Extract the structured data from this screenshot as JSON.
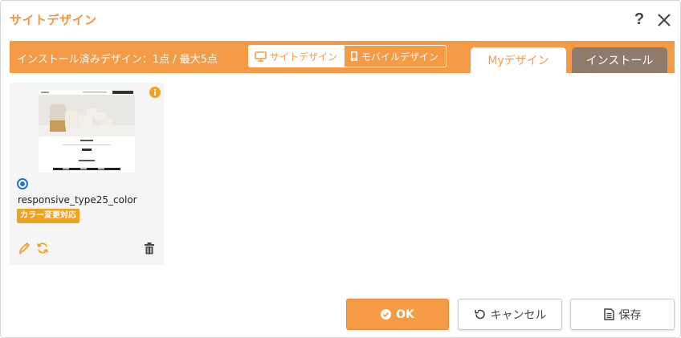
{
  "dialog": {
    "title": "サイトデザイン",
    "help_label": "?"
  },
  "toolbar": {
    "installed_text": "インストール済みデザイン：1点 / 最大5点",
    "view_toggle": {
      "site_label": "サイトデザイン",
      "mobile_label": "モバイルデザイン"
    },
    "tabs": [
      {
        "label": "Myデザイン",
        "active": true
      },
      {
        "label": "インストール",
        "active": false
      }
    ]
  },
  "designs": [
    {
      "name": "responsive_type25_color",
      "badge": "カラー変更対応",
      "selected": true,
      "icons": [
        "info-icon",
        "pencil-icon",
        "refresh-icon",
        "trash-icon"
      ]
    }
  ],
  "footer": {
    "ok_label": "OK",
    "cancel_label": "キャンセル",
    "save_label": "保存"
  },
  "colors": {
    "accent": "#f59a45",
    "title": "#f0953e",
    "tab_inactive": "#8f7b6b",
    "badge": "#f0a21c",
    "radio": "#1e73d6"
  }
}
